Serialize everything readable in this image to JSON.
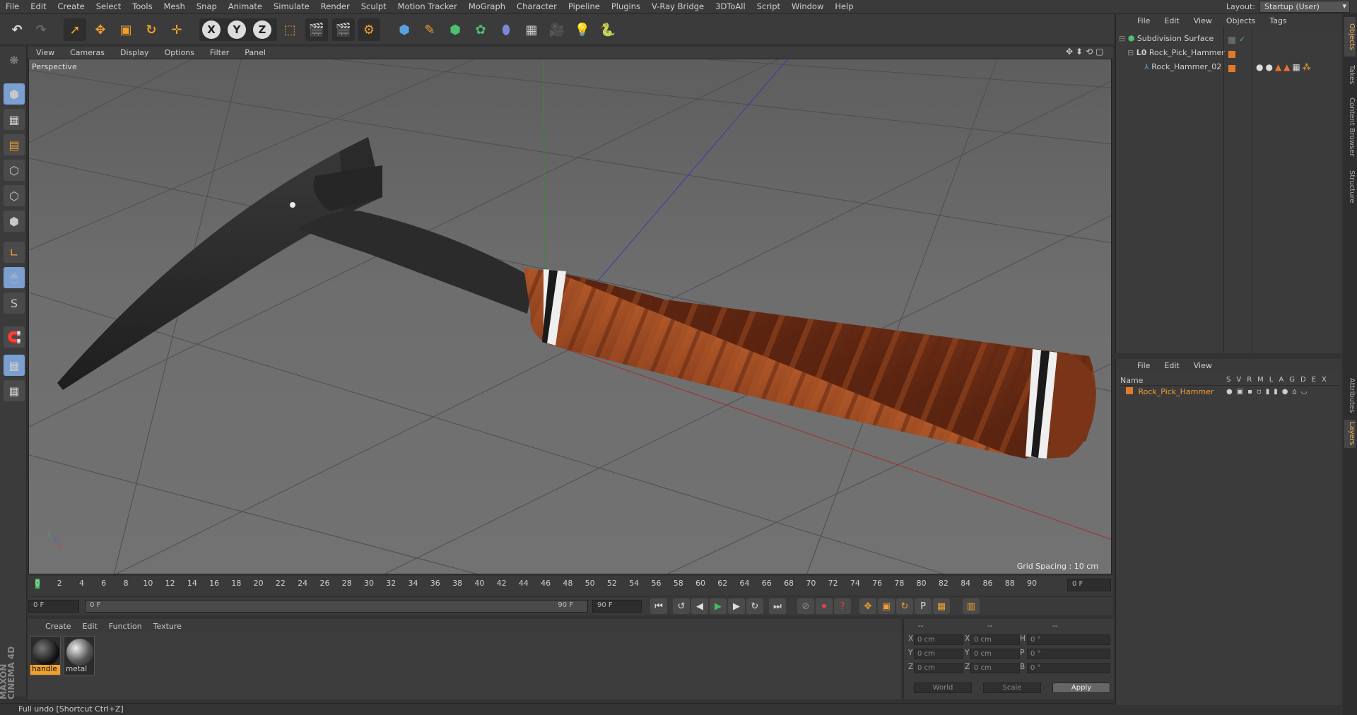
{
  "menu": [
    "File",
    "Edit",
    "Create",
    "Select",
    "Tools",
    "Mesh",
    "Snap",
    "Animate",
    "Simulate",
    "Render",
    "Sculpt",
    "Motion Tracker",
    "MoGraph",
    "Character",
    "Pipeline",
    "Plugins",
    "V-Ray Bridge",
    "3DToAll",
    "Script",
    "Window",
    "Help"
  ],
  "layout": {
    "label": "Layout:",
    "value": "Startup (User)"
  },
  "toolbar": {
    "x": "X",
    "y": "Y",
    "z": "Z"
  },
  "viewport": {
    "menu": [
      "View",
      "Cameras",
      "Display",
      "Options",
      "Filter",
      "Panel"
    ],
    "label": "Perspective",
    "grid_spacing": "Grid Spacing : 10 cm",
    "axes": {
      "y": "Y",
      "z": "Z",
      "x": "X"
    }
  },
  "timeline": {
    "ticks": [
      "0",
      "2",
      "4",
      "6",
      "8",
      "10",
      "12",
      "14",
      "16",
      "18",
      "20",
      "22",
      "24",
      "26",
      "28",
      "30",
      "32",
      "34",
      "36",
      "38",
      "40",
      "42",
      "44",
      "46",
      "48",
      "50",
      "52",
      "54",
      "56",
      "58",
      "60",
      "62",
      "64",
      "66",
      "68",
      "70",
      "72",
      "74",
      "76",
      "78",
      "80",
      "82",
      "84",
      "86",
      "88",
      "90"
    ],
    "current_frame": "0 F"
  },
  "playbar": {
    "start": "0 F",
    "range_start": "0 F",
    "range_end": "90 F",
    "end": "90 F"
  },
  "materials": {
    "menu": [
      "Create",
      "Edit",
      "Function",
      "Texture"
    ],
    "items": [
      {
        "name": "handle"
      },
      {
        "name": "metal"
      }
    ]
  },
  "coords": {
    "headers": [
      "--",
      "--",
      "--"
    ],
    "rows": [
      {
        "a": "X",
        "av": "0 cm",
        "b": "X",
        "bv": "0 cm",
        "c": "H",
        "cv": "0 °"
      },
      {
        "a": "Y",
        "av": "0 cm",
        "b": "Y",
        "bv": "0 cm",
        "c": "P",
        "cv": "0 °"
      },
      {
        "a": "Z",
        "av": "0 cm",
        "b": "Z",
        "bv": "0 cm",
        "c": "B",
        "cv": "0 °"
      }
    ],
    "space": "World",
    "mode": "Scale",
    "apply": "Apply"
  },
  "status": "Full undo [Shortcut Ctrl+Z]",
  "objects": {
    "menu": [
      "File",
      "Edit",
      "View",
      "Objects",
      "Tags"
    ],
    "tree": [
      "Subdivision Surface",
      "Rock_Pick_Hammer",
      "Rock_Hammer_02"
    ]
  },
  "layers": {
    "menu": [
      "File",
      "Edit",
      "View"
    ],
    "col_name": "Name",
    "cols": [
      "S",
      "V",
      "R",
      "M",
      "L",
      "A",
      "G",
      "D",
      "E",
      "X"
    ],
    "rows": [
      "Rock_Pick_Hammer"
    ]
  },
  "sidetabs": [
    "Objects",
    "Takes",
    "Content Browser",
    "Structure",
    "Attributes",
    "Layers"
  ],
  "logo": {
    "a": "MAXON",
    "b": "CINEMA 4D"
  },
  "colors": {
    "accent": "#f0a030",
    "layer": "#e07a2a",
    "handle": "#8a3c1c"
  }
}
